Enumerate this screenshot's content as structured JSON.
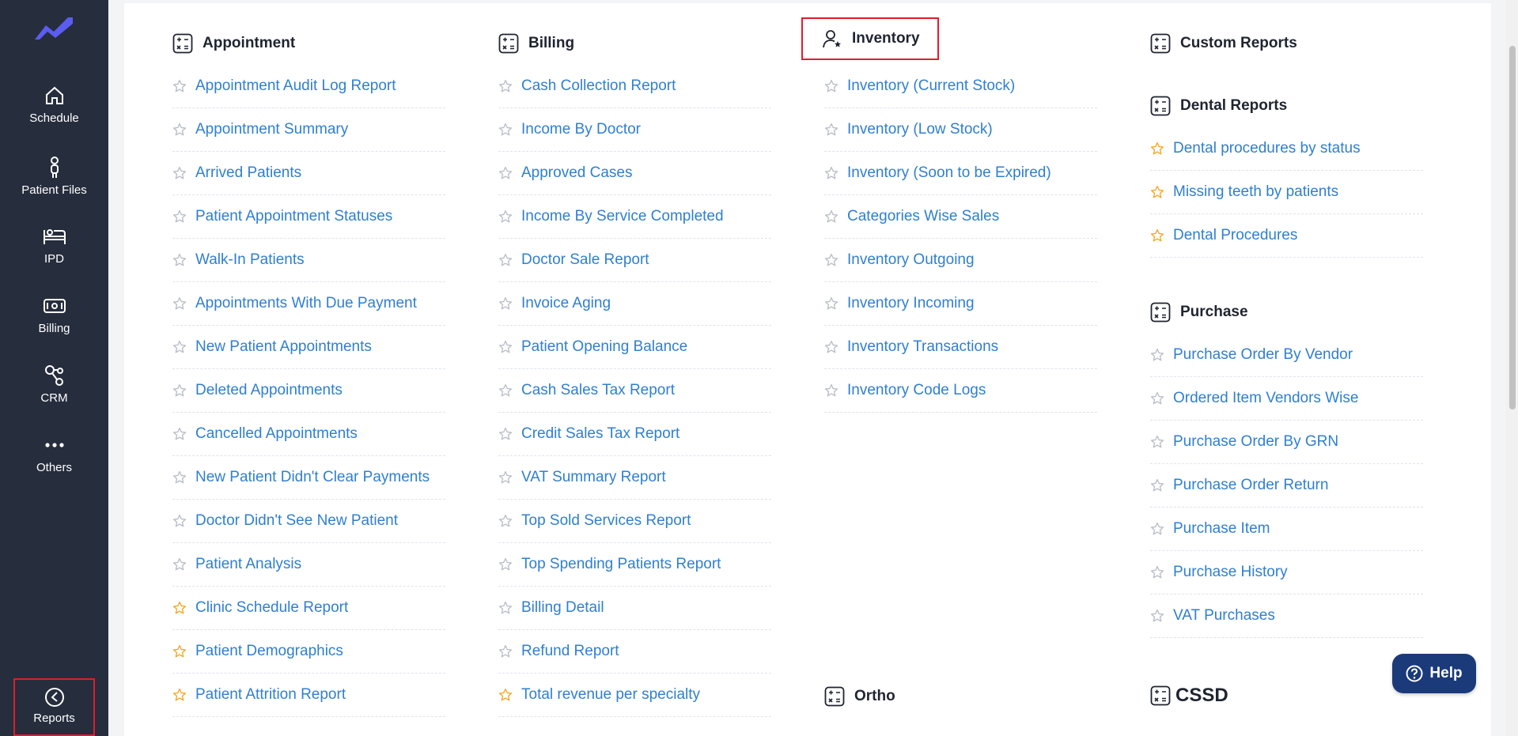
{
  "sidebar": {
    "items": [
      {
        "label": "Schedule",
        "icon": "home-icon"
      },
      {
        "label": "Patient Files",
        "icon": "patient-icon"
      },
      {
        "label": "IPD",
        "icon": "bed-icon"
      },
      {
        "label": "Billing",
        "icon": "billing-icon"
      },
      {
        "label": "CRM",
        "icon": "crm-icon"
      },
      {
        "label": "Others",
        "icon": "more-icon"
      },
      {
        "label": "Reports",
        "icon": "reports-icon"
      }
    ],
    "active": "Reports"
  },
  "colors": {
    "sidebar_bg": "#262d3d",
    "link": "#2f7fd0",
    "star_fav": "#f5a623",
    "star_plain": "#b9bec8",
    "highlight": "#e11d2a",
    "help_bg": "#1b3a7a",
    "logo": "#5b5cf0"
  },
  "appointment": {
    "title": "Appointment",
    "items": [
      {
        "label": "Appointment Audit Log Report",
        "fav": false
      },
      {
        "label": "Appointment Summary",
        "fav": false
      },
      {
        "label": "Arrived Patients",
        "fav": false
      },
      {
        "label": "Patient Appointment Statuses",
        "fav": false
      },
      {
        "label": "Walk-In Patients",
        "fav": false
      },
      {
        "label": "Appointments With Due Payment",
        "fav": false
      },
      {
        "label": "New Patient Appointments",
        "fav": false
      },
      {
        "label": "Deleted Appointments",
        "fav": false
      },
      {
        "label": "Cancelled Appointments",
        "fav": false
      },
      {
        "label": "New Patient Didn't Clear Payments",
        "fav": false
      },
      {
        "label": "Doctor Didn't See New Patient",
        "fav": false
      },
      {
        "label": "Patient Analysis",
        "fav": false
      },
      {
        "label": "Clinic Schedule Report",
        "fav": true
      },
      {
        "label": "Patient Demographics",
        "fav": true
      },
      {
        "label": "Patient Attrition Report",
        "fav": true
      }
    ]
  },
  "billing": {
    "title": "Billing",
    "items": [
      {
        "label": "Cash Collection Report",
        "fav": false
      },
      {
        "label": "Income By Doctor",
        "fav": false
      },
      {
        "label": "Approved Cases",
        "fav": false
      },
      {
        "label": "Income By Service Completed",
        "fav": false
      },
      {
        "label": "Doctor Sale Report",
        "fav": false
      },
      {
        "label": "Invoice Aging",
        "fav": false
      },
      {
        "label": "Patient Opening Balance",
        "fav": false
      },
      {
        "label": "Cash Sales Tax Report",
        "fav": false
      },
      {
        "label": "Credit Sales Tax Report",
        "fav": false
      },
      {
        "label": "VAT Summary Report",
        "fav": false
      },
      {
        "label": "Top Sold Services Report",
        "fav": false
      },
      {
        "label": "Top Spending Patients Report",
        "fav": false
      },
      {
        "label": "Billing Detail",
        "fav": false
      },
      {
        "label": "Refund Report",
        "fav": false
      },
      {
        "label": "Total revenue per specialty",
        "fav": true
      }
    ]
  },
  "inventory": {
    "title": "Inventory",
    "items": [
      {
        "label": "Inventory (Current Stock)",
        "fav": false
      },
      {
        "label": "Inventory (Low Stock)",
        "fav": false
      },
      {
        "label": "Inventory (Soon to be Expired)",
        "fav": false
      },
      {
        "label": "Categories Wise Sales",
        "fav": false
      },
      {
        "label": "Inventory Outgoing",
        "fav": false
      },
      {
        "label": "Inventory Incoming",
        "fav": false
      },
      {
        "label": "Inventory Transactions",
        "fav": false
      },
      {
        "label": "Inventory Code Logs",
        "fav": false
      }
    ]
  },
  "ortho": {
    "title": "Ortho"
  },
  "custom": {
    "title": "Custom Reports"
  },
  "dental": {
    "title": "Dental Reports",
    "items": [
      {
        "label": "Dental procedures by status",
        "fav": true
      },
      {
        "label": "Missing teeth by patients",
        "fav": true
      },
      {
        "label": "Dental Procedures",
        "fav": true
      }
    ]
  },
  "purchase": {
    "title": "Purchase",
    "items": [
      {
        "label": "Purchase Order By Vendor",
        "fav": false
      },
      {
        "label": "Ordered Item Vendors Wise",
        "fav": false
      },
      {
        "label": "Purchase Order By GRN",
        "fav": false
      },
      {
        "label": "Purchase Order Return",
        "fav": false
      },
      {
        "label": "Purchase Item",
        "fav": false
      },
      {
        "label": "Purchase History",
        "fav": false
      },
      {
        "label": "VAT Purchases",
        "fav": false
      }
    ]
  },
  "cssd": {
    "title": "CSSD"
  },
  "help": {
    "label": "Help"
  }
}
